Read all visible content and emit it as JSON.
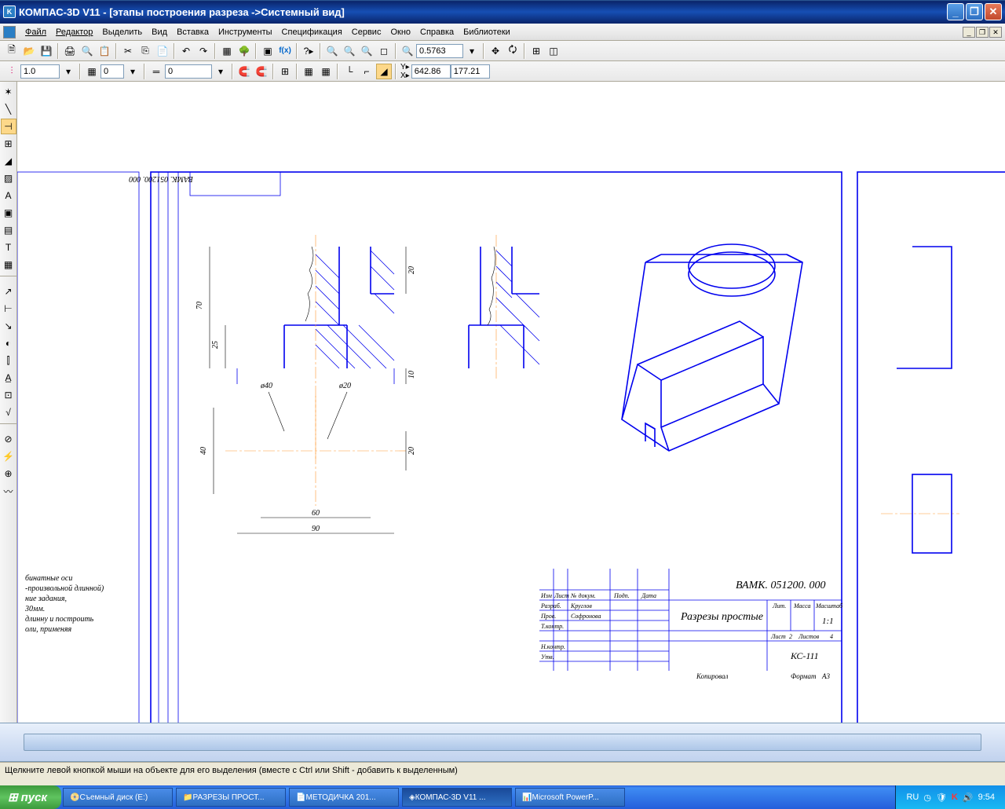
{
  "titlebar": {
    "app": "КОМПАС-3D V11",
    "doc": "[этапы построения разреза ->Системный вид]"
  },
  "menu": [
    "Файл",
    "Редактор",
    "Выделить",
    "Вид",
    "Вставка",
    "Инструменты",
    "Спецификация",
    "Сервис",
    "Окно",
    "Справка",
    "Библиотеки"
  ],
  "toolbar2": {
    "zoom": "0.5763"
  },
  "toolbar3": {
    "step": "1.0",
    "layer": "0",
    "style": "0",
    "x": "642.86",
    "y": "177.21"
  },
  "drawing": {
    "code_rot": "ВАМК. 051200. 000",
    "dims": {
      "d70": "70",
      "d25": "25",
      "d20t": "20",
      "d10": "10",
      "phi40": "ø40",
      "phi20": "ø20",
      "d40": "40",
      "d60": "60",
      "d90": "90",
      "d20s": "20"
    },
    "side_text": [
      "бинатные оси",
      "-произвольной длинной)",
      "ние задания,",
      "30мм.",
      "длинну и построить",
      "оли, применяя"
    ],
    "stamp": {
      "code": "ВАМК. 051200. 000",
      "name": "Разрезы простые",
      "scale": "1:1",
      "group": "КС-111",
      "h_izm": "Изм",
      "h_list": "Лист",
      "h_doc": "№ докум.",
      "h_sign": "Подп.",
      "h_date": "Дата",
      "r_razr": "Разраб.",
      "r_prov": "Пров.",
      "r_tkontr": "Т.контр.",
      "r_nkontr": "Н.контр.",
      "r_utv": "Утв.",
      "n_razr": "Круглов",
      "n_prov": "Софронова",
      "lit": "Лит.",
      "massa": "Масса",
      "mash": "Масштаб",
      "list": "Лист",
      "listn": "2",
      "listov": "Листов",
      "listovn": "4",
      "kopir": "Копировал",
      "format": "Формат",
      "a3": "А3"
    }
  },
  "status": "Щелкните левой кнопкой мыши на объекте для его выделения (вместе с Ctrl или Shift - добавить к выделенным)",
  "taskbar": {
    "start": "пуск",
    "tasks": [
      "Съемный диск (E:)",
      "РАЗРЕЗЫ ПРОСТ...",
      "МЕТОДИЧКА 201...",
      "КОМПАС-3D V11 ...",
      "Microsoft PowerP..."
    ],
    "lang": "RU",
    "time": "9:54"
  }
}
